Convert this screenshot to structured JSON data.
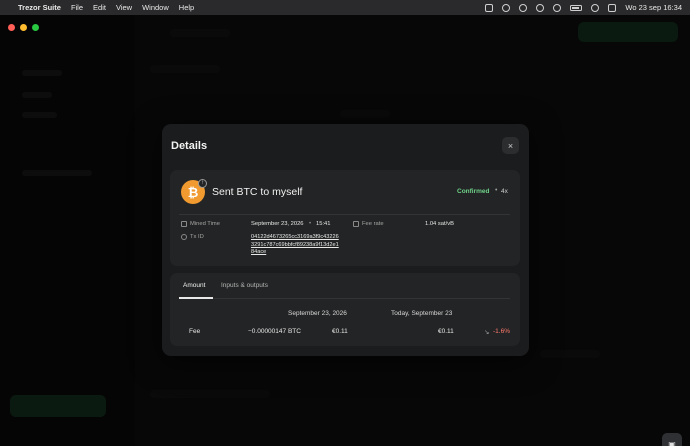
{
  "menubar": {
    "apple": "",
    "app_name": "Trezor Suite",
    "menus": [
      "File",
      "Edit",
      "View",
      "Window",
      "Help"
    ],
    "clock": "Wo 23 sep  16:34"
  },
  "modal": {
    "title": "Details",
    "close_icon": "×",
    "tx": {
      "coin_symbol": "₿",
      "badge": "↑",
      "title": "Sent BTC to myself",
      "status": "Confirmed",
      "dot": "•",
      "confirmations": "4x"
    },
    "details": {
      "mined_time_label": "Mined Time",
      "mined_date": "September 23, 2026",
      "mined_time": "15:41",
      "fee_rate_label": "Fee rate",
      "fee_rate_value": "1.04 sat/vB",
      "txid_label": "Tx ID",
      "txid_value": "04122d4673265cc3169a3f9c432263291c787c69bbfcf89238a9f13d2e184ace"
    },
    "tabs": {
      "amount": "Amount",
      "inputs_outputs": "Inputs & outputs"
    },
    "amount_table": {
      "header_date_then": "September 23, 2026",
      "header_date_now": "Today, September 23",
      "row_label": "Fee",
      "row_btc": "−0.00000147 BTC",
      "row_fiat_then": "€0.11",
      "row_fiat_now": "€0.11",
      "row_change_icon": "↘",
      "row_change": "-1.6%"
    }
  },
  "colors": {
    "accent_green": "#6fd28a",
    "bitcoin_orange": "#f09a30",
    "negative": "#ff7a6e"
  }
}
